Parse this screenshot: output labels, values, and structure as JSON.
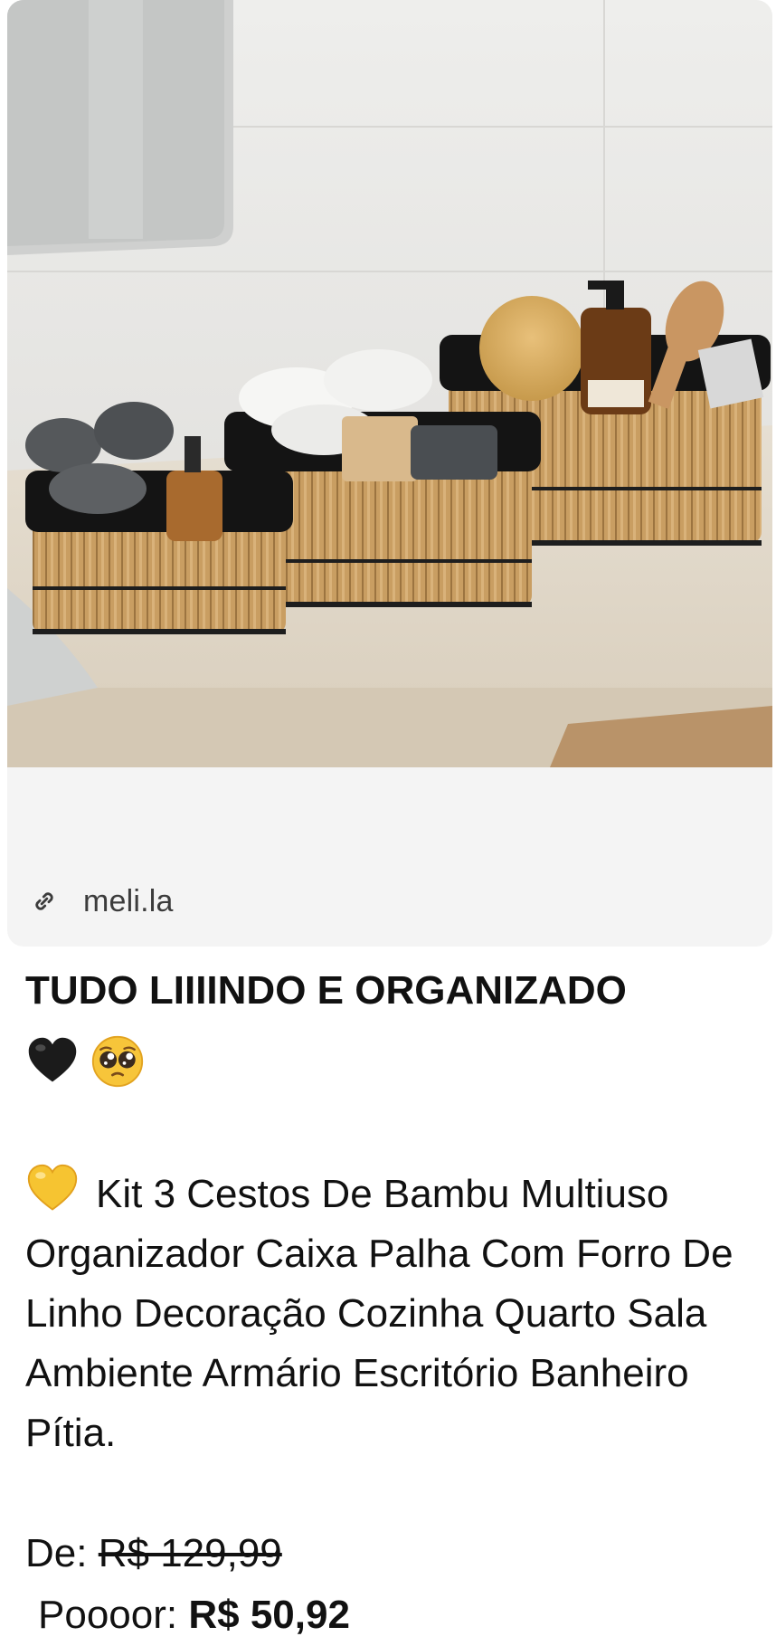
{
  "link_preview": {
    "image_alt": "Kit 3 cestos de bambu com forro preto sobre bancada de banheiro",
    "domain": "meli.la",
    "link_icon": "link-icon"
  },
  "message": {
    "headline": "TUDO LIIIINDO E ORGANIZADO",
    "headline_emojis": [
      "black-heart-icon",
      "pleading-face-icon"
    ],
    "body_emoji": "yellow-heart-icon",
    "body_text": "Kit 3 Cestos De  Bambu Multiuso Organizador Caixa Palha Com Forro De  Linho Decoração Cozinha Quarto Sala Ambiente Armário Escritório Banheiro Pítia.",
    "price_from_label": "De:",
    "price_from": "R$ 129,99",
    "price_to_label": "Poooor:",
    "price_to": "R$ 50,92"
  },
  "colors": {
    "card_bg": "#f4f4f4",
    "text": "#111111",
    "link_text": "#3c3c3c"
  }
}
